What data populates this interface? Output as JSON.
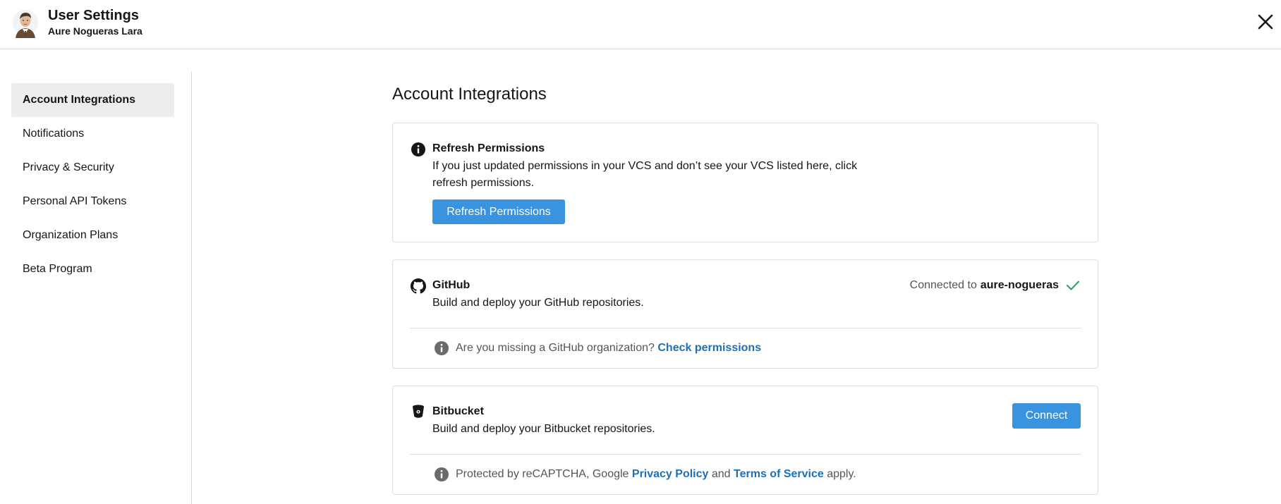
{
  "header": {
    "title": "User Settings",
    "user_name": "Aure Nogueras Lara"
  },
  "sidebar": {
    "items": [
      {
        "label": "Account Integrations",
        "active": true
      },
      {
        "label": "Notifications",
        "active": false
      },
      {
        "label": "Privacy & Security",
        "active": false
      },
      {
        "label": "Personal API Tokens",
        "active": false
      },
      {
        "label": "Organization Plans",
        "active": false
      },
      {
        "label": "Beta Program",
        "active": false
      }
    ]
  },
  "main": {
    "title": "Account Integrations",
    "refresh": {
      "title": "Refresh Permissions",
      "description_line1": "If you just updated permissions in your VCS and don’t see your VCS listed here, click",
      "description_line2": "refresh permissions.",
      "button_label": "Refresh Permissions"
    },
    "github": {
      "title": "GitHub",
      "description": "Build and deploy your GitHub repositories.",
      "connected_prefix": "Connected to",
      "connected_user": "aure-nogueras",
      "note_text": "Are you missing a GitHub organization?",
      "note_link": "Check permissions"
    },
    "bitbucket": {
      "title": "Bitbucket",
      "description": "Build and deploy your Bitbucket repositories.",
      "connect_label": "Connect",
      "note_prefix": "Protected by reCAPTCHA, Google",
      "privacy_link": "Privacy Policy",
      "note_and": "and",
      "terms_link": "Terms of Service",
      "note_suffix": "apply."
    }
  },
  "colors": {
    "accent": "#3a93df",
    "link": "#1f6fb7",
    "success": "#1ea55b",
    "active_nav_bg": "#ededed"
  },
  "icons": {
    "close": "close-icon",
    "info": "info-icon",
    "github": "github-icon",
    "bitbucket": "bitbucket-icon",
    "check": "check-icon"
  }
}
